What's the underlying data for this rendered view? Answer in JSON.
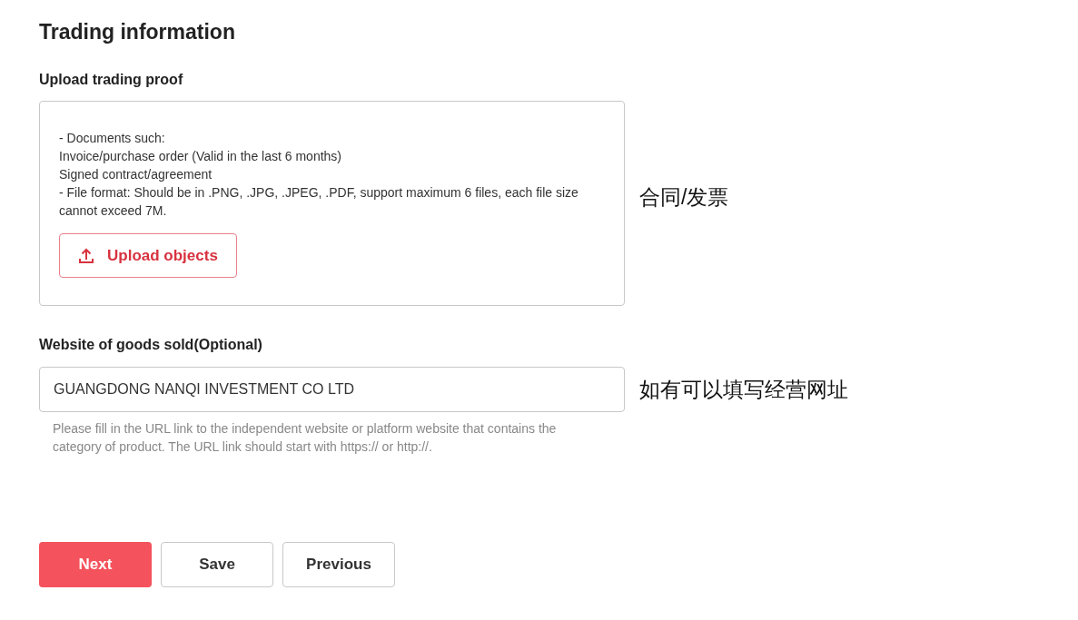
{
  "section_title": "Trading information",
  "upload": {
    "label": "Upload trading proof",
    "lines": [
      "- Documents such:",
      "Invoice/purchase order (Valid in the last 6 months)",
      "Signed contract/agreement",
      "- File format: Should be in .PNG, .JPG, .JPEG, .PDF, support maximum 6 files, each file size cannot exceed 7M."
    ],
    "button": "Upload objects",
    "note": "合同/发票"
  },
  "website": {
    "label": "Website of goods sold(Optional)",
    "value": "GUANGDONG NANQI INVESTMENT CO LTD",
    "help": "Please fill in the URL link to the independent website or platform website that contains the category of product. The URL link should start with https:// or http://.",
    "note": "如有可以填写经营网址"
  },
  "buttons": [
    {
      "label": "Next",
      "kind": "primary"
    },
    {
      "label": "Save",
      "kind": "secondary"
    },
    {
      "label": "Previous",
      "kind": "secondary"
    }
  ]
}
